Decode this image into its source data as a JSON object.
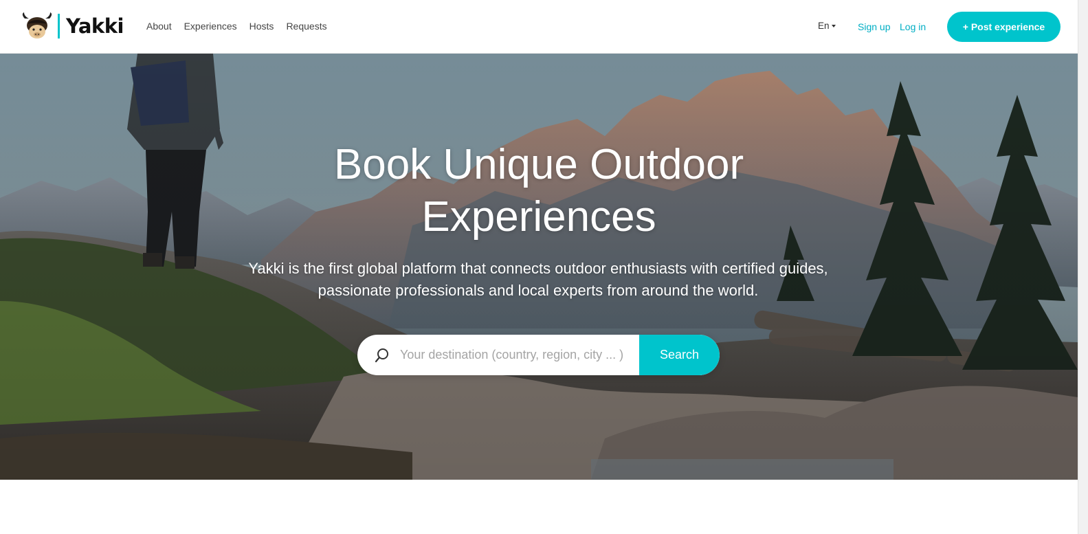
{
  "brand": {
    "name": "Yakki",
    "accent_color": "#00c4cc"
  },
  "nav": {
    "links": [
      "About",
      "Experiences",
      "Hosts",
      "Requests"
    ],
    "language": "En",
    "signup": "Sign up",
    "login": "Log in",
    "post_button": "+ Post experience"
  },
  "hero": {
    "title_line1": "Book Unique Outdoor",
    "title_line2": "Experiences",
    "subtitle": "Yakki is the first global platform that connects outdoor enthusiasts with certified guides, passionate professionals and local experts from around the world.",
    "search_placeholder": "Your destination (country, region, city ... )",
    "search_button": "Search",
    "icons": [
      "search-icon"
    ]
  }
}
